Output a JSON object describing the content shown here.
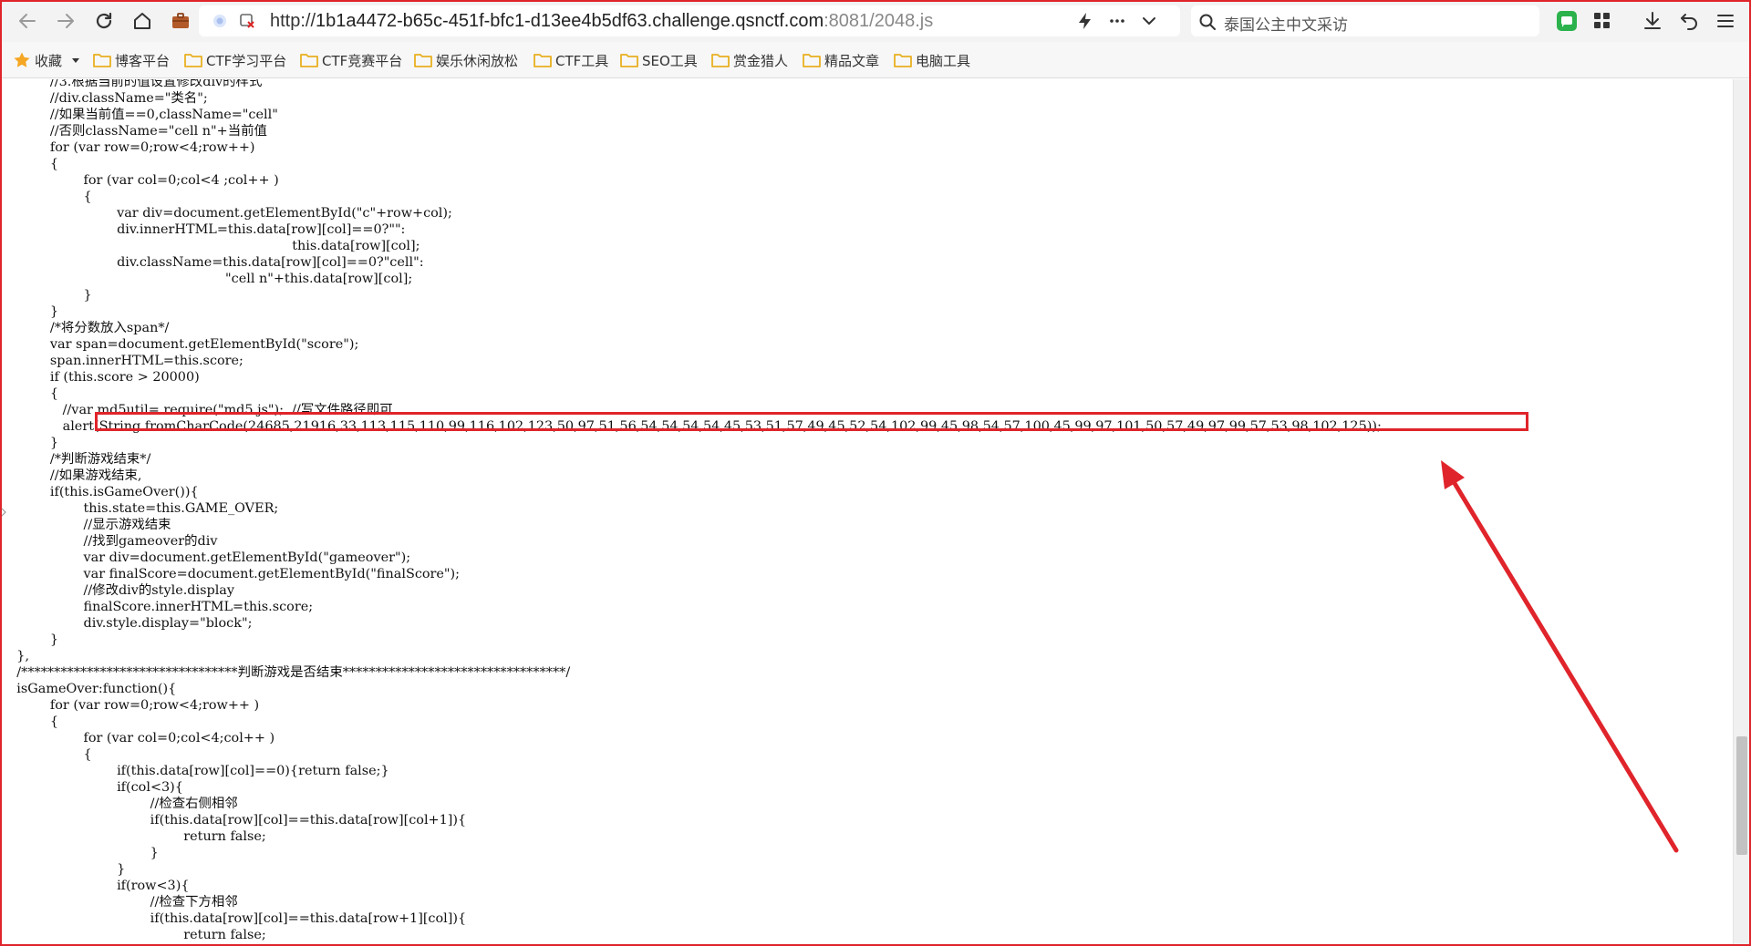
{
  "browser": {
    "url_scheme": "http://",
    "url_host": "1b1a4472-b65c-451f-bfc1-d13ee4b5df63.challenge.qsnctf.com",
    "url_tail": ":8081/2048.js",
    "search_text": "泰国公主中文采访"
  },
  "bookmarks": [
    {
      "label": "收藏"
    },
    {
      "label": "博客平台"
    },
    {
      "label": "CTF学习平台"
    },
    {
      "label": "CTF竞赛平台"
    },
    {
      "label": "娱乐休闲放松"
    },
    {
      "label": "CTF工具"
    },
    {
      "label": "SEO工具"
    },
    {
      "label": "赏金猎人"
    },
    {
      "label": "精品文章"
    },
    {
      "label": "电脑工具"
    }
  ],
  "code_lines": [
    "            //3.根据当前的值设置修改div的样式",
    "            //div.className=\"类名\";",
    "            //如果当前值==0,className=\"cell\"",
    "            //否则className=\"cell n\"+当前值",
    "            for (var row=0;row<4;row++)",
    "            {",
    "                    for (var col=0;col<4 ;col++ )",
    "                    {",
    "                            var div=document.getElementById(\"c\"+row+col);",
    "                            div.innerHTML=this.data[row][col]==0?\"\":",
    "                                                                      this.data[row][col];",
    "                            div.className=this.data[row][col]==0?\"cell\":",
    "                                                      \"cell n\"+this.data[row][col];",
    "                    }",
    "            }",
    "            /*将分数放入span*/",
    "            var span=document.getElementById(\"score\");",
    "            span.innerHTML=this.score;",
    "            if (this.score > 20000)",
    "            {",
    "               //var md5util= require(\"md5.js\");  //写文件路径即可",
    "               alert(String.fromCharCode(24685,21916,33,113,115,110,99,116,102,123,50,97,51,56,54,54,54,54,45,53,51,57,49,45,52,54,102,99,45,98,54,57,100,45,99,97,101,50,57,49,97,99,57,53,98,102,125));",
    "            }",
    "            /*判断游戏结束*/",
    "            //如果游戏结束,",
    "            if(this.isGameOver()){",
    "                    this.state=this.GAME_OVER;",
    "                    //显示游戏结束",
    "                    //找到gameover的div",
    "                    var div=document.getElementById(\"gameover\");",
    "                    var finalScore=document.getElementById(\"finalScore\");",
    "                    //修改div的style.display",
    "                    finalScore.innerHTML=this.score;",
    "                    div.style.display=\"block\";",
    "            }",
    "    },",
    "    /*********************************判断游戏是否结束**********************************/",
    "    isGameOver:function(){",
    "            for (var row=0;row<4;row++ )",
    "            {",
    "                    for (var col=0;col<4;col++ )",
    "                    {",
    "                            if(this.data[row][col]==0){return false;}",
    "                            if(col<3){",
    "                                    //检查右侧相邻",
    "                                    if(this.data[row][col]==this.data[row][col+1]){",
    "                                            return false;",
    "                                    }",
    "                            }",
    "                            if(row<3){",
    "                                    //检查下方相邻",
    "                                    if(this.data[row][col]==this.data[row+1][col]){",
    "                                            return false;",
    "                                    }"
  ],
  "colors": {
    "annotation_red": "#e0242b",
    "folder_yellow": "#f5c243",
    "star_orange": "#f5a623"
  }
}
